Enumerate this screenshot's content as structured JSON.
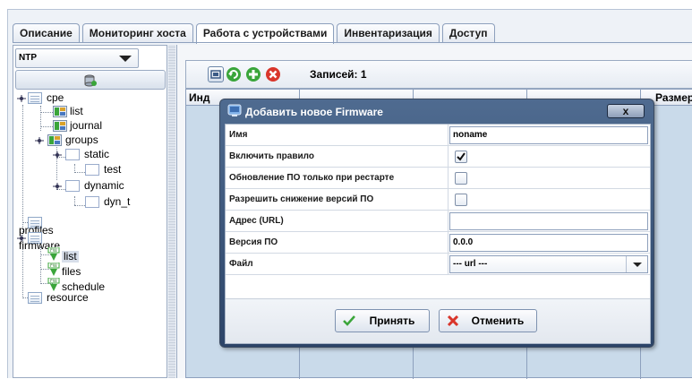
{
  "tabs": [
    {
      "label": "Описание"
    },
    {
      "label": "Мониторинг хоста"
    },
    {
      "label": "Работа с устройствами",
      "active": true
    },
    {
      "label": "Инвентаризация"
    },
    {
      "label": "Доступ"
    }
  ],
  "left_panel": {
    "selector_value": "NTP",
    "tree": {
      "cpe": "cpe",
      "list": "list",
      "journal": "journal",
      "groups": "groups",
      "static": "static",
      "test": "test",
      "dynamic": "dynamic",
      "dyn_t": "dyn_t",
      "profiles": "profiles",
      "firmware": "firmware",
      "fw_list": "list",
      "files": "files",
      "schedule": "schedule",
      "resource": "resource"
    },
    "selected_node": "firmware/list"
  },
  "toolbar": {
    "records_label": "Записей: 1"
  },
  "grid": {
    "header_left": "Инд",
    "header_right": "Размер"
  },
  "dialog": {
    "title": "Добавить новое Firmware",
    "close_label": "x",
    "fields": {
      "name_label": "Имя",
      "name_value": "noname",
      "enable_label": "Включить правило",
      "enable_checked": true,
      "restart_label": "Обновление ПО только при рестарте",
      "restart_checked": false,
      "downgrade_label": "Разрешить снижение версий ПО",
      "downgrade_checked": false,
      "url_label": "Адрес (URL)",
      "url_value": "",
      "version_label": "Версия ПО",
      "version_value": "0.0.0",
      "file_label": "Файл",
      "file_value": "--- url ---"
    },
    "accept_label": "Принять",
    "cancel_label": "Отменить"
  },
  "colors": {
    "accent_green": "#3aa53a",
    "accent_red": "#d9362b",
    "dialog_title_bg": "#3d5679",
    "grid_bg": "#c9daea"
  }
}
